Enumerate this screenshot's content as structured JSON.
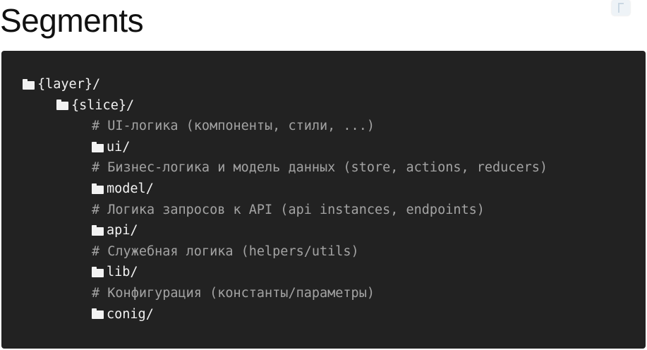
{
  "slide": {
    "title": "Segments"
  },
  "code": {
    "lines": [
      {
        "kind": "folder",
        "indent": 0,
        "text": "{layer}/"
      },
      {
        "kind": "folder",
        "indent": 1,
        "text": "{slice}/"
      },
      {
        "kind": "comment",
        "indent": 2,
        "text": "# UI-логика (компоненты, стили, ...)"
      },
      {
        "kind": "folder",
        "indent": 2,
        "text": "ui/"
      },
      {
        "kind": "comment",
        "indent": 2,
        "text": "# Бизнес-логика и модель данных (store, actions, reducers)"
      },
      {
        "kind": "folder",
        "indent": 2,
        "text": "model/"
      },
      {
        "kind": "comment",
        "indent": 2,
        "text": "# Логика запросов к API (api instances, endpoints)"
      },
      {
        "kind": "folder",
        "indent": 2,
        "text": "api/"
      },
      {
        "kind": "comment",
        "indent": 2,
        "text": "# Служебная логика (helpers/utils)"
      },
      {
        "kind": "folder",
        "indent": 2,
        "text": "lib/"
      },
      {
        "kind": "comment",
        "indent": 2,
        "text": "# Конфигурация (константы/параметры)"
      },
      {
        "kind": "folder",
        "indent": 2,
        "text": "conig/"
      }
    ],
    "icons": {
      "folder": "folder-icon"
    },
    "colors": {
      "background": "#222222",
      "folder_text": "#f2f2f2",
      "comment_text": "#a3a3a3"
    }
  }
}
